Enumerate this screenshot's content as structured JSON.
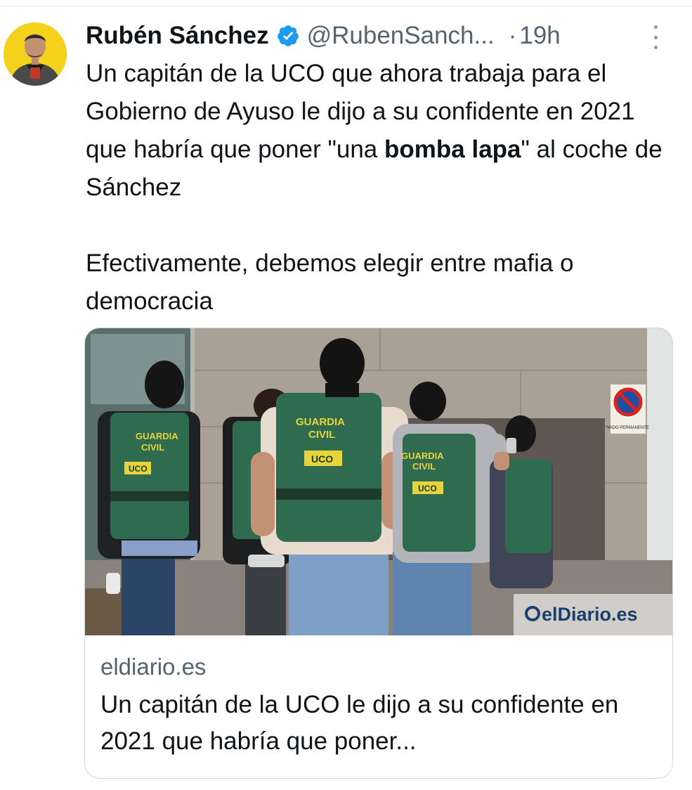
{
  "author": {
    "name": "Rubén Sánchez",
    "handle": "@RubenSanch...",
    "separator": "·",
    "time": "19h",
    "verified_color": "#1d9bf0"
  },
  "tweet": {
    "line1_start": "Un capitán de la UCO que ahora trabaja para el Gobierno de Ayuso le dijo a su confidente en 2021 que habría que poner \"una ",
    "line1_bold1": "bomba",
    "line1_space": " ",
    "line1_bold2": "lapa",
    "line1_end": "\" al coche de Sánchez",
    "paragraph2": "Efectivamente, debemos elegir entre mafia o democracia"
  },
  "card": {
    "image": {
      "vest_text_1": "GUARDIA",
      "vest_text_2": "CIVIL",
      "badge_text": "UCO",
      "sign_text": "VADO PERMANENTE",
      "watermark_text": "elDiario.es"
    },
    "domain": "eldiario.es",
    "title": "Un capitán de la UCO le dijo a su confidente en 2021 que habría que poner..."
  },
  "icons": {
    "verified": "verified-badge-icon",
    "more": "more-options-icon"
  },
  "colors": {
    "text": "#0f1419",
    "secondary": "#536471",
    "border": "#cfd9de",
    "avatar_bg": "#f4d11b",
    "vest_green": "#2f6b4f"
  }
}
